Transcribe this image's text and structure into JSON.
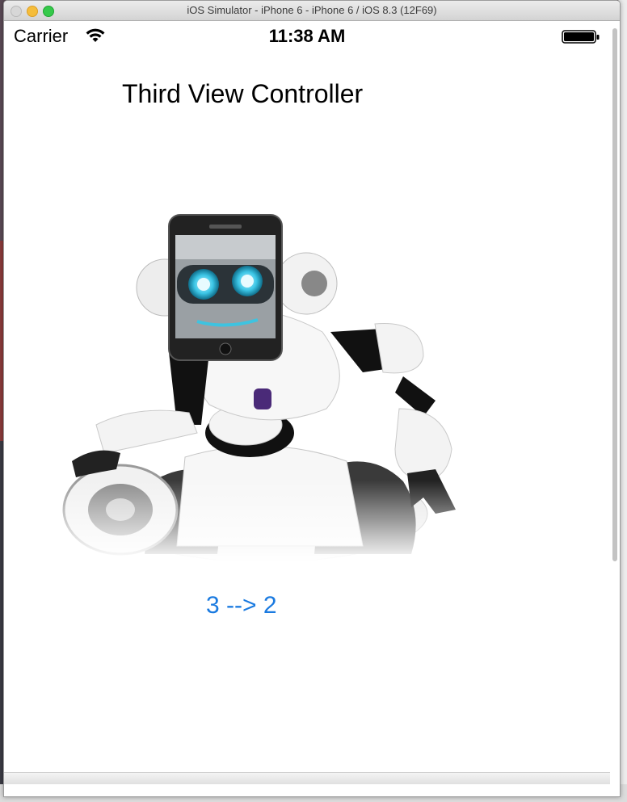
{
  "window": {
    "title": "iOS Simulator - iPhone 6 - iPhone 6 / iOS 8.3 (12F69)"
  },
  "statusbar": {
    "carrier": "Carrier",
    "time": "11:38 AM",
    "wifi_icon": "wifi-icon",
    "battery_icon": "battery-icon",
    "battery_level": 1.0
  },
  "screen": {
    "title": "Third View Controller",
    "image": "robot-image",
    "button_label": "3 --> 2"
  },
  "colors": {
    "button_tint": "#1a7ae0",
    "background": "#ffffff",
    "text": "#000000"
  }
}
